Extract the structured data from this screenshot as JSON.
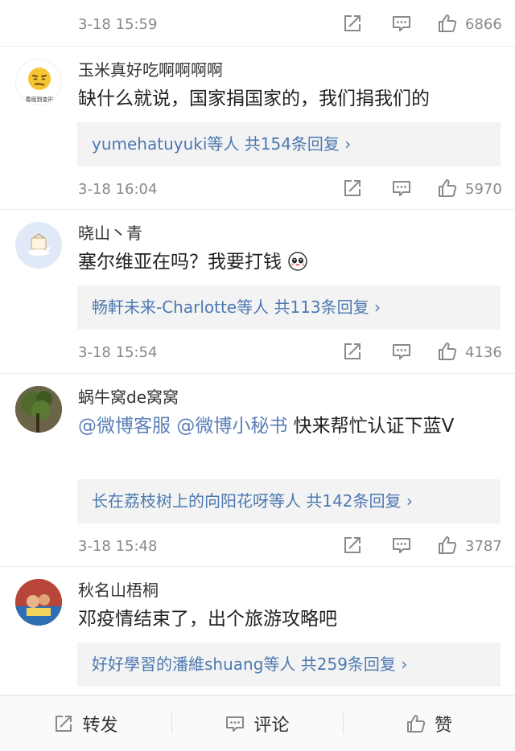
{
  "top_item": {
    "time": "3-18 15:59",
    "likes": "6866"
  },
  "comments": [
    {
      "username": "玉米真好吃啊啊啊啊",
      "avatar_caption": "委屈到变形",
      "content": "缺什么就说，国家捐国家的，我们捐我们的",
      "reply_summary": "yumehatuyuki等人 共154条回复",
      "time": "3-18 16:04",
      "likes": "5970"
    },
    {
      "username": "晓山丶青",
      "content": "塞尔维亚在吗？我要打钱",
      "reply_summary": "畅軒未来-Charlotte等人 共113条回复",
      "time": "3-18 15:54",
      "likes": "4136"
    },
    {
      "username": "蜗牛窝de窝窝",
      "content_mention_1": "@微博客服",
      "content_mention_2": "@微博小秘书",
      "content_rest": "快来帮忙认证下蓝V",
      "reply_summary": "长在荔枝树上的向阳花呀等人 共142条回复",
      "time": "3-18 15:48",
      "likes": "3787"
    },
    {
      "username": "秋名山梧桐",
      "content": "邓疫情结束了，出个旅游攻略吧",
      "reply_summary": "好好學習的潘維shuang等人 共259条回复"
    }
  ],
  "bottom_bar": {
    "repost_label": "转发",
    "comment_label": "评论",
    "like_label": "赞"
  },
  "reply_chevron": "›",
  "icons": [
    "share-icon",
    "comment-icon",
    "thumbs-up-icon",
    "emoji-icon"
  ],
  "colors": {
    "link": "#4d79b1",
    "muted": "#888888",
    "reply_bg": "#f3f3f3"
  }
}
